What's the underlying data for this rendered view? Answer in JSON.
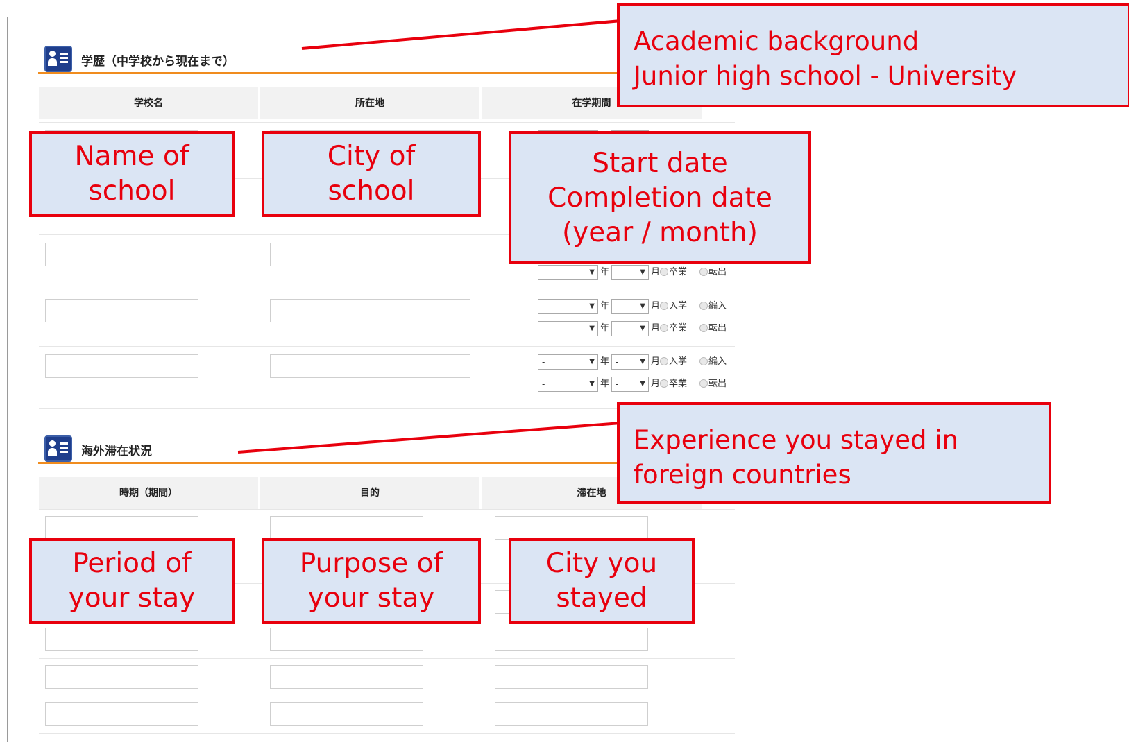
{
  "education": {
    "title": "学歴（中学校から現在まで）",
    "columns": [
      "学校名",
      "所在地",
      "在学期間"
    ],
    "date_row_start": {
      "year_value": "-",
      "year_unit": "年",
      "month_value": "-",
      "month_unit": "月",
      "option1": "入学",
      "option2": "編入"
    },
    "date_row_end": {
      "year_value": "-",
      "year_unit": "年",
      "month_value": "-",
      "month_unit": "月",
      "option1": "卒業",
      "option2": "転出"
    }
  },
  "overseas": {
    "title": "海外滞在状況",
    "columns": [
      "時期（期間）",
      "目的",
      "滞在地"
    ]
  },
  "callouts": {
    "academic_line1": "Academic background",
    "academic_line2": "Junior high school - University",
    "name_line1": "Name of",
    "name_line2": "school",
    "city_line1": "City of",
    "city_line2": "school",
    "dates_line1": "Start date",
    "dates_line2": "Completion date",
    "dates_line3": "(year / month)",
    "experience_line1": "Experience you stayed in",
    "experience_line2": "foreign countries",
    "period_line1": "Period of",
    "period_line2": "your stay",
    "purpose_line1": "Purpose of",
    "purpose_line2": "your stay",
    "cityyou_line1": "City you",
    "cityyou_line2": "stayed"
  },
  "colors": {
    "callout_border": "#e8000d",
    "callout_fill": "#dbe5f4",
    "section_rule": "#f08c1e",
    "icon_blue": "#1f3e8c"
  }
}
